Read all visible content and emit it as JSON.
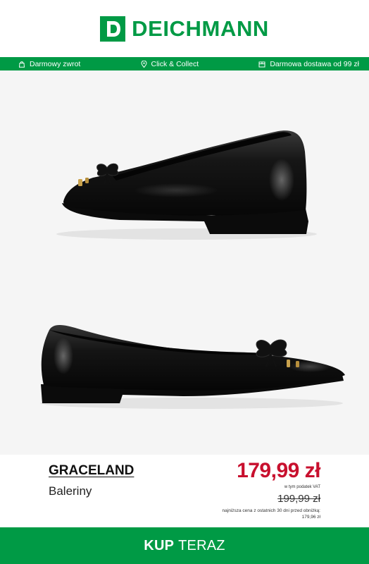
{
  "header": {
    "logo_letter": "D",
    "logo_text": "DEICHMANN"
  },
  "usp_bar": {
    "items": [
      {
        "icon": "return-bag-icon",
        "label": "Darmowy zwrot"
      },
      {
        "icon": "location-pin-icon",
        "label": "Click & Collect"
      },
      {
        "icon": "delivery-box-icon",
        "label": "Darmowa dostawa od 99 zł"
      }
    ]
  },
  "product": {
    "brand": "GRACELAND",
    "category": "Baleriny",
    "price": "179,99 zł",
    "vat_note": "w tym podatek VAT",
    "old_price": "199,99 zł",
    "lowest_price_note": "najniższa cena z ostatnich 30 dni przed obniżką: 179,96 zł"
  },
  "cta": {
    "bold": "KUP",
    "rest": "TERAZ"
  },
  "colors": {
    "brand_green": "#009a45",
    "price_red": "#c8102e"
  }
}
